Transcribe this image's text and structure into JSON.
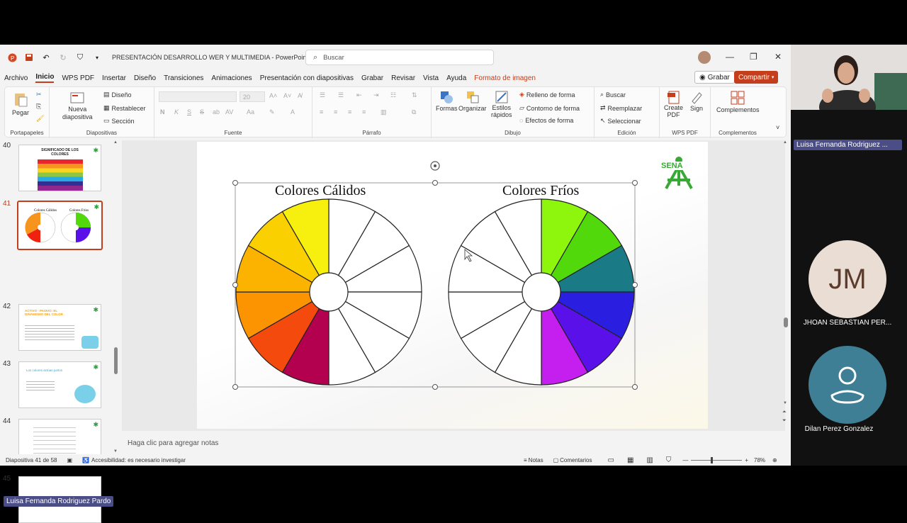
{
  "titlebar": {
    "doc_title": "PRESENTACIÓN DESARROLLO WER Y MULTIMEDIA  -  PowerPoint",
    "search_placeholder": "Buscar"
  },
  "menu": {
    "items": [
      "Archivo",
      "Inicio",
      "WPS PDF",
      "Insertar",
      "Diseño",
      "Transiciones",
      "Animaciones",
      "Presentación con diapositivas",
      "Grabar",
      "Revisar",
      "Vista",
      "Ayuda",
      "Formato de imagen"
    ],
    "grabar": "Grabar",
    "compartir": "Compartir"
  },
  "ribbon": {
    "portapapeles": {
      "label": "Portapapeles",
      "pegar": "Pegar"
    },
    "diapositivas": {
      "label": "Diapositivas",
      "nueva": "Nueva",
      "diapositiva": "diapositiva",
      "diseno": "Diseño",
      "restablecer": "Restablecer",
      "seccion": "Sección"
    },
    "fuente": {
      "label": "Fuente",
      "size": "20"
    },
    "parrafo": {
      "label": "Párrafo"
    },
    "dibujo": {
      "label": "Dibujo",
      "formas": "Formas",
      "organizar": "Organizar",
      "estilos": "Estilos",
      "rapidos": "rápidos",
      "relleno": "Relleno de forma",
      "contorno": "Contorno de forma",
      "efectos": "Efectos de forma"
    },
    "edicion": {
      "label": "Edición",
      "buscar": "Buscar",
      "reemplazar": "Reemplazar",
      "seleccionar": "Seleccionar"
    },
    "wpspdf": {
      "label": "WPS PDF",
      "create": "Create",
      "pdf": "PDF",
      "sign": "Sign"
    },
    "complementos": {
      "label": "Complementos",
      "btn": "Complementos"
    }
  },
  "thumbnails": [
    {
      "num": "40",
      "title": "SIGNIFICADO DE LOS COLORES"
    },
    {
      "num": "41",
      "title": "Colores Cálidos / Colores Fríos"
    },
    {
      "num": "42",
      "title": "ACTIVO - PASIVO: EL DINAMISMO DEL COLOR"
    },
    {
      "num": "43",
      "title": "Los colores actúan juntos"
    },
    {
      "num": "44",
      "title": ""
    },
    {
      "num": "45",
      "title": ""
    }
  ],
  "slide": {
    "warm_title": "Colores Cálidos",
    "cool_title": "Colores Fríos",
    "logo_text": "SENA",
    "warm_colors": [
      "#f7ef0d",
      "#fbd000",
      "#fbb300",
      "#fb9400",
      "#f96d00",
      "#f44a0d",
      "#ef220f",
      "#b3004f"
    ],
    "cool_colors": [
      "#8ef50c",
      "#52d90c",
      "#1fbf0f",
      "#1a7a86",
      "#2a1fe0",
      "#5a10e8",
      "#9a18e8",
      "#c51ff0"
    ]
  },
  "notes_placeholder": "Haga clic para agregar notas",
  "status": {
    "slide_info": "Diapositiva 41 de 58",
    "accessibility": "Accesibilidad: es necesario investigar",
    "notas": "Notas",
    "comentarios": "Comentarios",
    "zoom": "78%"
  },
  "participants": {
    "presenter": "Luisa Fernanda Rodriguez ...",
    "p1_initials": "JM",
    "p1_name": "JHOAN SEBASTIAN PER...",
    "p2_name": "Dilan Perez Gonzalez",
    "bottom_name": "Luisa Fernanda Rodriguez Pardo"
  }
}
